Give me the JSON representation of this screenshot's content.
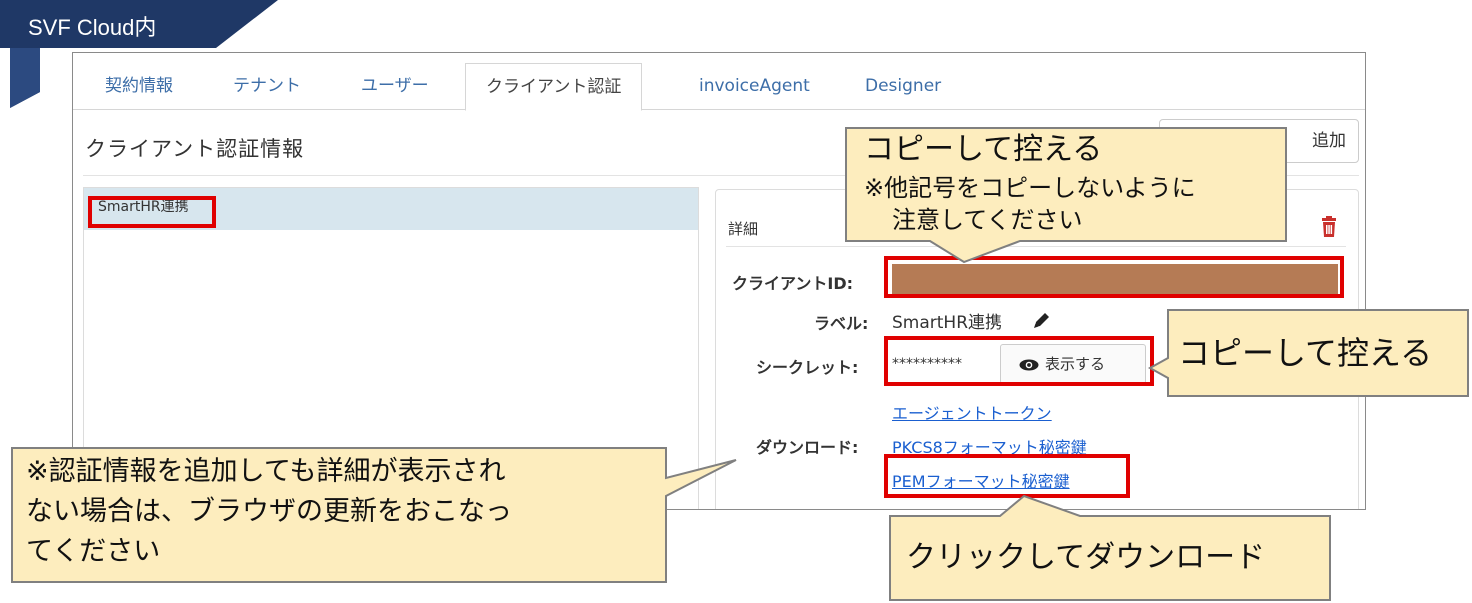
{
  "header": {
    "title": "SVF Cloud内",
    "bg_color": "#1f3866"
  },
  "tabs": [
    {
      "label": "契約情報",
      "active": false
    },
    {
      "label": "テナント",
      "active": false
    },
    {
      "label": "ユーザー",
      "active": false
    },
    {
      "label": "クライアント認証",
      "active": true
    },
    {
      "label": "invoiceAgent",
      "active": false
    },
    {
      "label": "Designer",
      "active": false
    }
  ],
  "section": {
    "title": "クライアント認証情報",
    "add_button_label": "追加"
  },
  "client_list": {
    "items": [
      {
        "label": "SmartHR連携",
        "selected": true
      }
    ]
  },
  "detail": {
    "title": "詳細",
    "client_id_label": "クライアントID:",
    "label_label": "ラベル:",
    "label_value": "SmartHR連携",
    "secret_label": "シークレット:",
    "secret_mask": "**********",
    "show_button_label": "表示する",
    "download_label": "ダウンロード:",
    "links": [
      "エージェントトークン",
      "PKCS8フォーマット秘密鍵",
      "PEMフォーマット秘密鍵"
    ]
  },
  "callouts": {
    "client_id_line1": "コピーして控える",
    "client_id_line2": "※他記号をコピーしないように",
    "client_id_line3": "注意してください",
    "secret": "コピーして控える",
    "refresh_line1": "※認証情報を追加しても詳細が表示され",
    "refresh_line2": "ない場合は、ブラウザの更新をおこなっ",
    "refresh_line3": "てください",
    "download": "クリックしてダウンロード"
  },
  "colors": {
    "highlight": "#e00000",
    "callout_fill": "#fdedbe",
    "link": "#1a5fd0",
    "tab_link": "#3d6ea8",
    "masked_field": "#b57b55",
    "trash": "#c9302c"
  },
  "icons": [
    "pencil-icon",
    "eye-icon",
    "trash-icon"
  ]
}
